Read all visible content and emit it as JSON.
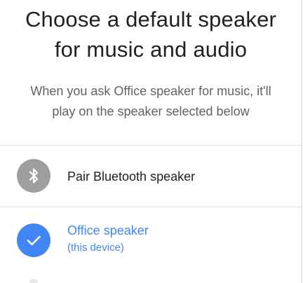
{
  "header": {
    "title_line1": "Choose a default speaker",
    "title_line2": "for music and audio"
  },
  "description": {
    "line1": "When you ask Office speaker for music, it'll",
    "line2": "play on the speaker selected below"
  },
  "options": {
    "pair_bluetooth": {
      "label": "Pair Bluetooth speaker",
      "icon": "bluetooth-icon",
      "icon_bg": "#9e9e9e"
    },
    "office_speaker": {
      "name": "Office speaker",
      "sublabel": "(this device)",
      "selected": true,
      "icon": "checkmark-icon",
      "accent": "#4285f4"
    }
  }
}
